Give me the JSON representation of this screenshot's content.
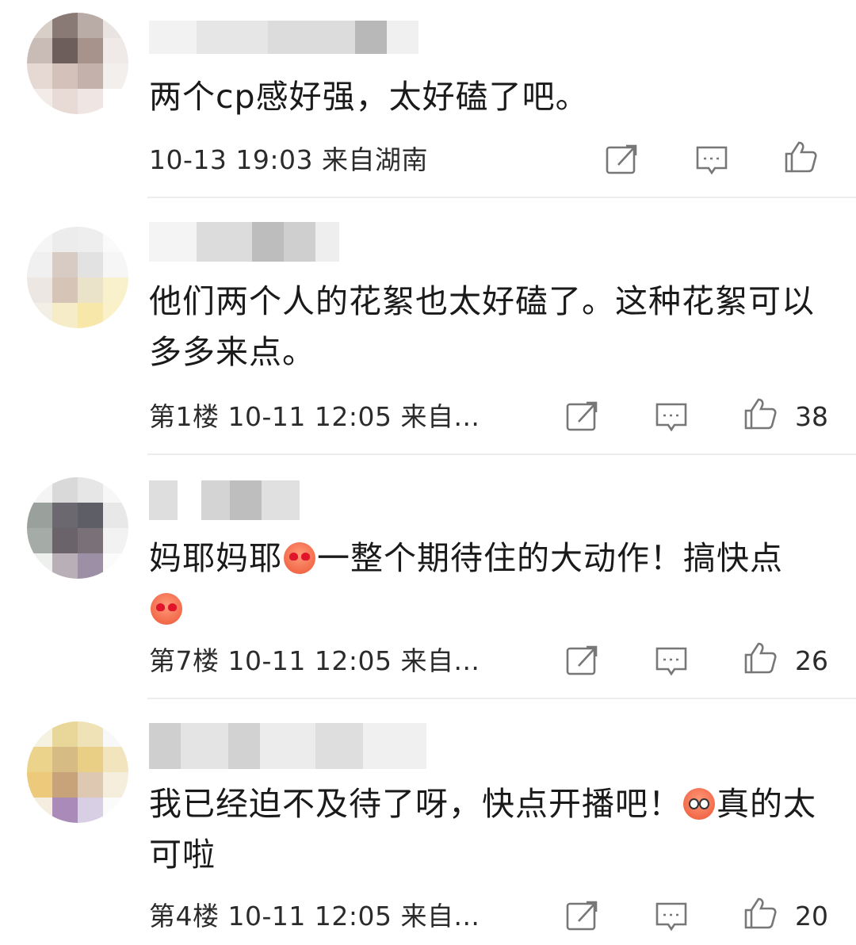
{
  "comments": [
    {
      "text": "两个cp感好强，太好磕了吧。",
      "meta": "10-13 19:03 来自湖南",
      "likes": ""
    },
    {
      "text": "他们两个人的花絮也太好磕了。这种花絮可以多多来点。",
      "meta": "第1楼 10-11 12:05 来自...",
      "likes": "38"
    },
    {
      "text_before": "妈耶妈耶",
      "text_after": "一整个期待住的大动作！搞快点",
      "meta": "第7楼 10-11 12:05 来自...",
      "likes": "26"
    },
    {
      "text_before": "我已经迫不及待了呀，快点开播吧！",
      "text_after": "真的太可啦",
      "meta": "第4楼 10-11 12:05 来自...",
      "likes": "20"
    }
  ],
  "icons": {
    "repost": "share-icon",
    "comment": "comment-icon",
    "like": "thumbs-up-icon"
  }
}
